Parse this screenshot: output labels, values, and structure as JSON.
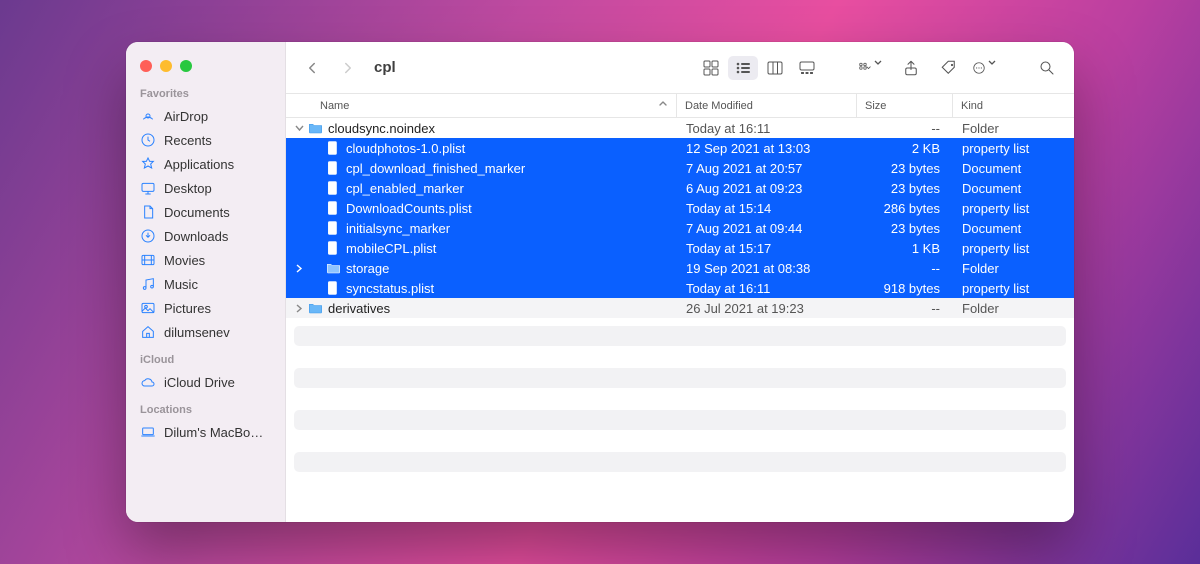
{
  "window": {
    "title": "cpl"
  },
  "sidebar": {
    "groups": [
      {
        "title": "Favorites",
        "items": [
          {
            "label": "AirDrop",
            "icon": "airdrop-icon"
          },
          {
            "label": "Recents",
            "icon": "clock-icon"
          },
          {
            "label": "Applications",
            "icon": "applications-icon"
          },
          {
            "label": "Desktop",
            "icon": "desktop-icon"
          },
          {
            "label": "Documents",
            "icon": "document-icon"
          },
          {
            "label": "Downloads",
            "icon": "downloads-icon"
          },
          {
            "label": "Movies",
            "icon": "movies-icon"
          },
          {
            "label": "Music",
            "icon": "music-icon"
          },
          {
            "label": "Pictures",
            "icon": "pictures-icon"
          },
          {
            "label": "dilumsenev",
            "icon": "home-icon"
          }
        ]
      },
      {
        "title": "iCloud",
        "items": [
          {
            "label": "iCloud Drive",
            "icon": "cloud-icon"
          }
        ]
      },
      {
        "title": "Locations",
        "items": [
          {
            "label": "Dilum's MacBo…",
            "icon": "laptop-icon"
          }
        ]
      }
    ]
  },
  "columns": {
    "name": "Name",
    "date": "Date Modified",
    "size": "Size",
    "kind": "Kind"
  },
  "rows": [
    {
      "type": "folder",
      "level": 0,
      "disclosure": "down",
      "selected": false,
      "name": "cloudsync.noindex",
      "date": "Today at 16:11",
      "size": "--",
      "kind": "Folder"
    },
    {
      "type": "file",
      "level": 1,
      "disclosure": "",
      "selected": true,
      "name": "cloudphotos-1.0.plist",
      "date": "12 Sep 2021 at 13:03",
      "size": "2 KB",
      "kind": "property list"
    },
    {
      "type": "file",
      "level": 1,
      "disclosure": "",
      "selected": true,
      "name": "cpl_download_finished_marker",
      "date": "7 Aug 2021 at 20:57",
      "size": "23 bytes",
      "kind": "Document"
    },
    {
      "type": "file",
      "level": 1,
      "disclosure": "",
      "selected": true,
      "name": "cpl_enabled_marker",
      "date": "6 Aug 2021 at 09:23",
      "size": "23 bytes",
      "kind": "Document"
    },
    {
      "type": "file",
      "level": 1,
      "disclosure": "",
      "selected": true,
      "name": "DownloadCounts.plist",
      "date": "Today at 15:14",
      "size": "286 bytes",
      "kind": "property list"
    },
    {
      "type": "file",
      "level": 1,
      "disclosure": "",
      "selected": true,
      "name": "initialsync_marker",
      "date": "7 Aug 2021 at 09:44",
      "size": "23 bytes",
      "kind": "Document"
    },
    {
      "type": "file",
      "level": 1,
      "disclosure": "",
      "selected": true,
      "name": "mobileCPL.plist",
      "date": "Today at 15:17",
      "size": "1 KB",
      "kind": "property list"
    },
    {
      "type": "folder",
      "level": 1,
      "disclosure": "right",
      "selected": true,
      "name": "storage",
      "date": "19 Sep 2021 at 08:38",
      "size": "--",
      "kind": "Folder"
    },
    {
      "type": "file",
      "level": 1,
      "disclosure": "",
      "selected": true,
      "name": "syncstatus.plist",
      "date": "Today at 16:11",
      "size": "918 bytes",
      "kind": "property list"
    },
    {
      "type": "folder",
      "level": 0,
      "disclosure": "right",
      "selected": false,
      "name": "derivatives",
      "date": "26 Jul 2021 at 19:23",
      "size": "--",
      "kind": "Folder"
    }
  ]
}
